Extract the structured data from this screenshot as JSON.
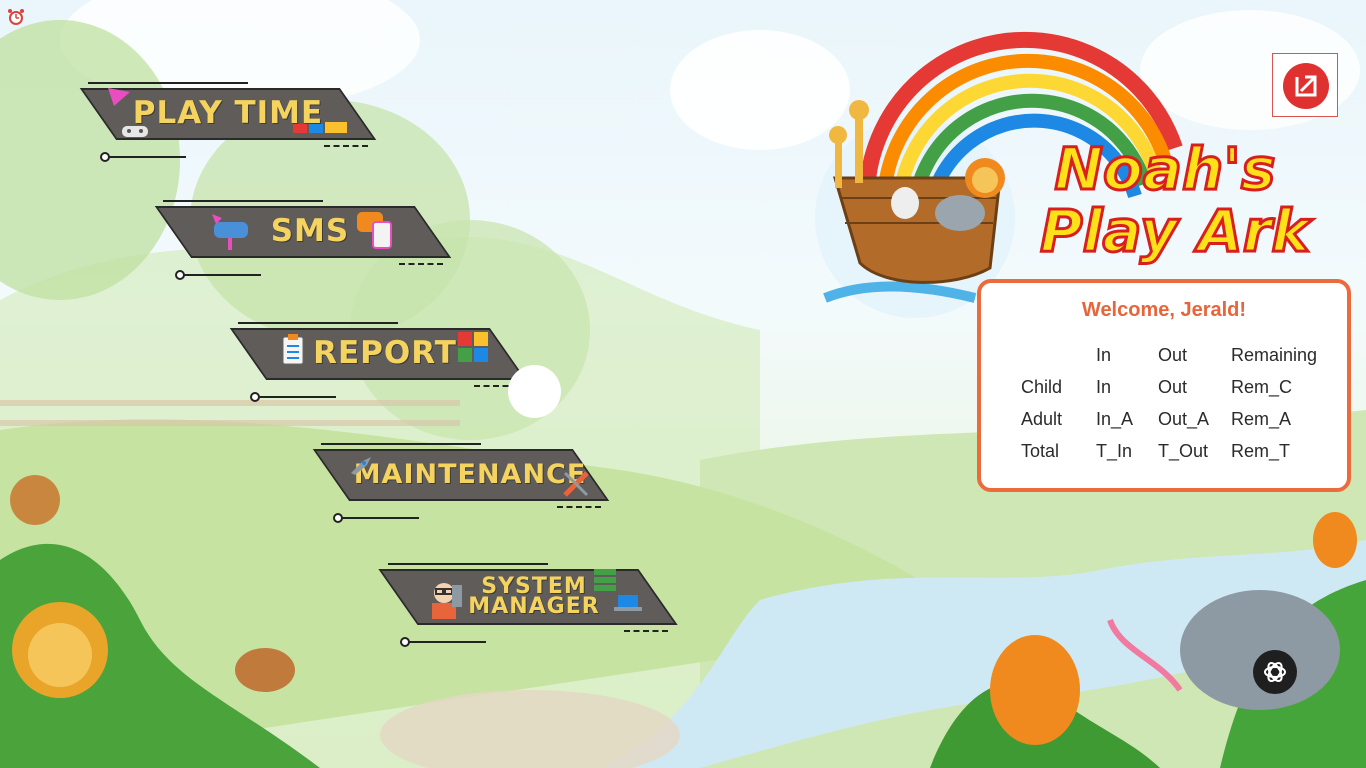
{
  "app": {
    "title": "Noah's Play Ark",
    "title_line1": "Noah's",
    "title_line2": "Play Ark"
  },
  "menu": {
    "play_time": "PLAY TIME",
    "sms": "SMS",
    "report": "REPORT",
    "maintenance": "MAINTENANCE",
    "system_manager_line1": "SYSTEM",
    "system_manager_line2": "MANAGER"
  },
  "welcome": {
    "greeting": "Welcome, Jerald!",
    "header": [
      "",
      "In",
      "Out",
      "Remaining"
    ],
    "rows": [
      [
        "Child",
        "In",
        "Out",
        "Rem_C"
      ],
      [
        "Adult",
        "In_A",
        "Out_A",
        "Rem_A"
      ],
      [
        "Total",
        "T_In",
        "T_Out",
        "Rem_T"
      ]
    ]
  },
  "icons": {
    "alarm": "alarm-clock-icon",
    "exit": "exit-icon",
    "assistant": "chatgpt-icon"
  },
  "colors": {
    "button_text": "#f4d35e",
    "button_panel": "#5f5c5a",
    "card_border": "#ec6b3c",
    "welcome_text": "#e8643a",
    "exit_red": "#e03131"
  }
}
